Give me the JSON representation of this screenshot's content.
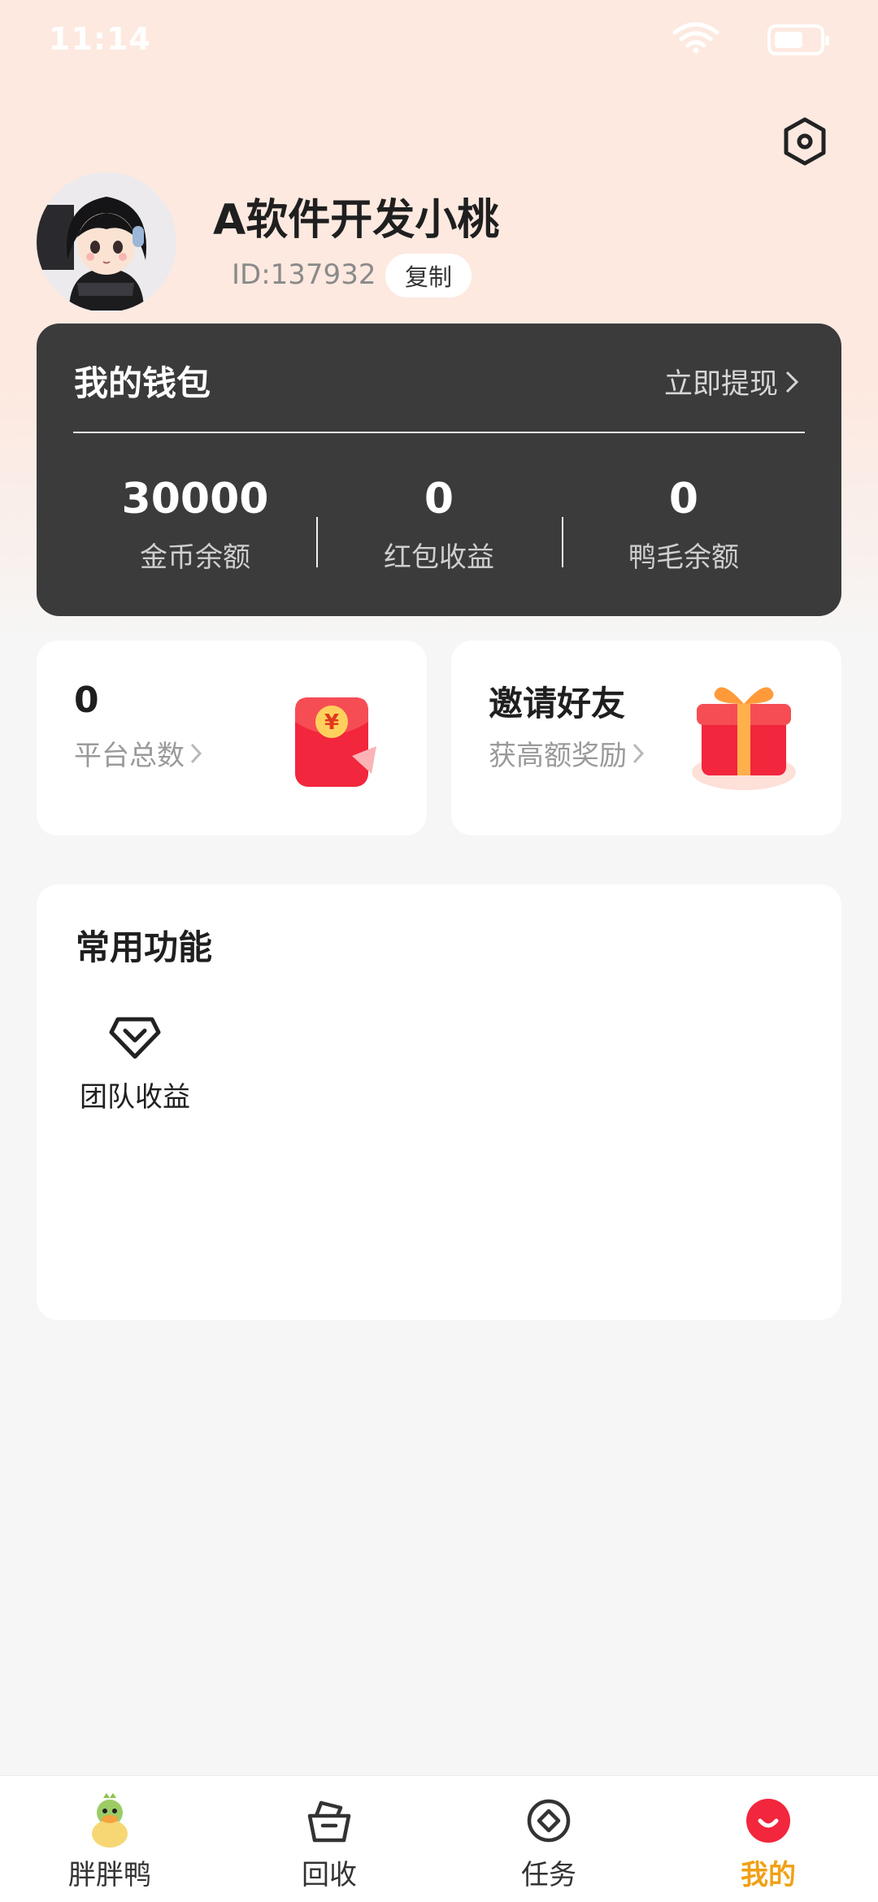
{
  "status_bar": {
    "time": "11:14"
  },
  "profile": {
    "username": "A软件开发小桃",
    "id_text": "ID:137932",
    "copy_label": "复制"
  },
  "wallet": {
    "title": "我的钱包",
    "withdraw_label": "立即提现",
    "stats": [
      {
        "value": "30000",
        "label": "金币余额"
      },
      {
        "value": "0",
        "label": "红包收益"
      },
      {
        "value": "0",
        "label": "鸭毛余额"
      }
    ]
  },
  "cards": {
    "platform": {
      "value": "0",
      "label": "平台总数"
    },
    "invite": {
      "title": "邀请好友",
      "label": "获高额奖励"
    }
  },
  "features": {
    "title": "常用功能",
    "items": [
      {
        "label": "团队收益",
        "icon": "diamond-chevron-icon"
      }
    ]
  },
  "nav": {
    "items": [
      {
        "label": "胖胖鸭",
        "icon": "duck-icon"
      },
      {
        "label": "回收",
        "icon": "basket-icon"
      },
      {
        "label": "任务",
        "icon": "task-circle-icon"
      },
      {
        "label": "我的",
        "icon": "smile-profile-icon",
        "active": true
      }
    ]
  },
  "colors": {
    "accent": "#f0a016",
    "wallet_bg": "#3b3b3b",
    "red": "#f2263c",
    "header_bg": "#fde9e0"
  }
}
